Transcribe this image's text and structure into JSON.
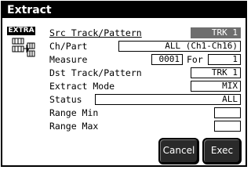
{
  "window": {
    "title": "Extract"
  },
  "sidebar": {
    "badge": "EXTRA",
    "icon": "extract-icon"
  },
  "rows": {
    "src_track_pattern": {
      "label": "Src Track/Pattern",
      "value": "TRK 1"
    },
    "ch_part": {
      "label": "Ch/Part",
      "value": "ALL (Ch1-Ch16)"
    },
    "measure": {
      "label": "Measure",
      "from": "0001",
      "for_label": "For",
      "for_value": "1"
    },
    "dst_track_pattern": {
      "label": "Dst Track/Pattern",
      "value": "TRK 1"
    },
    "extract_mode": {
      "label": "Extract Mode",
      "value": "MIX"
    },
    "status": {
      "label": "Status",
      "value": "ALL"
    },
    "range_min": {
      "label": "Range Min",
      "value": ""
    },
    "range_max": {
      "label": "Range Max",
      "value": ""
    }
  },
  "buttons": {
    "cancel": "Cancel",
    "exec": "Exec"
  },
  "colors": {
    "selected_field": "#6e6e6e",
    "title_bar": "#000000",
    "button": "#2a2a2a"
  }
}
